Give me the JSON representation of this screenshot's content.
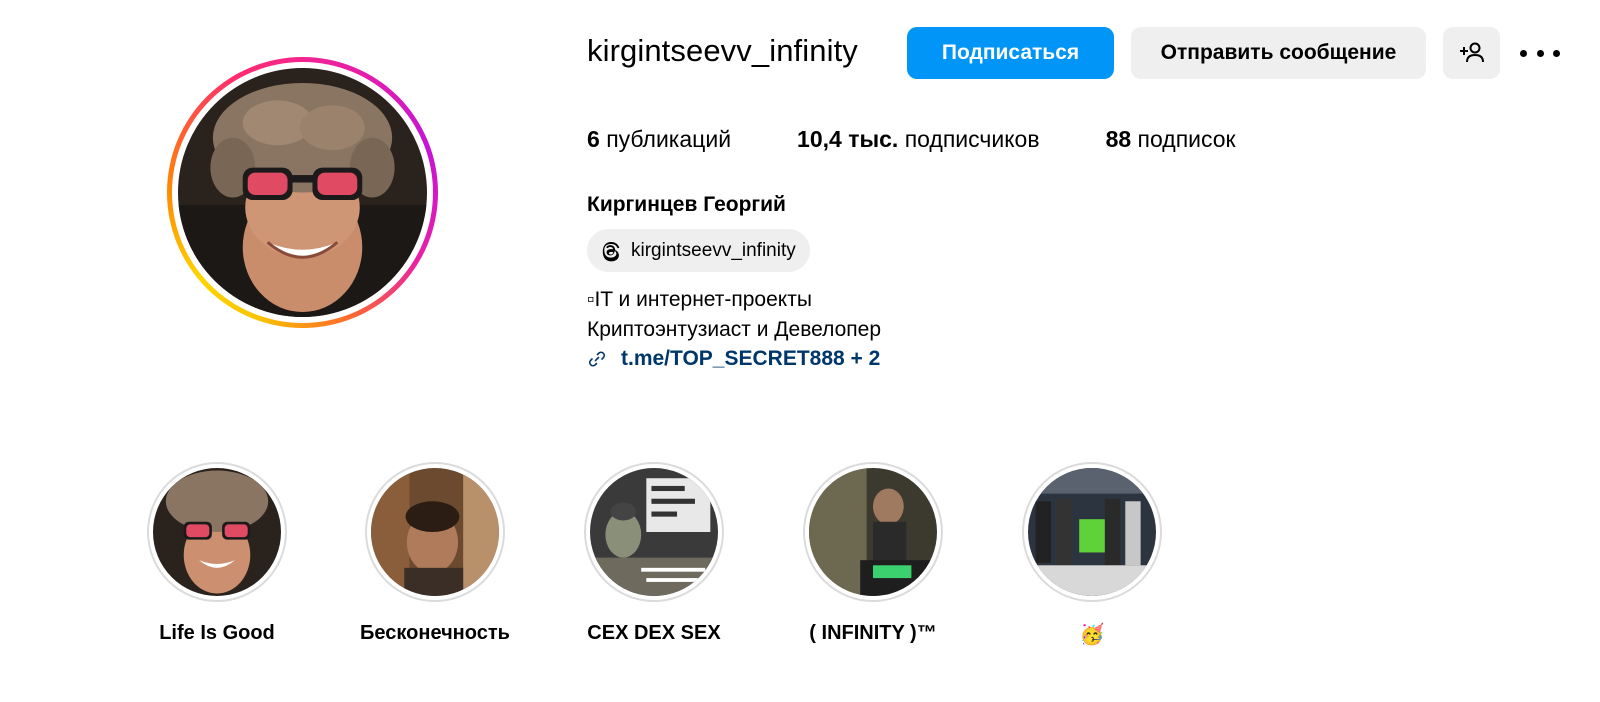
{
  "profile": {
    "username": "kirgintseevv_infinity",
    "full_name": "Киргинцев Георгий",
    "avatar_icon": "profile-photo-sunglasses-fur-hat"
  },
  "actions": {
    "follow_label": "Подписаться",
    "message_label": "Отправить сообщение",
    "add_user_icon": "add-user-icon",
    "more_icon": "more-options-icon"
  },
  "stats": {
    "posts_count": "6",
    "posts_label": "публикаций",
    "followers_count": "10,4 тыс.",
    "followers_label": "подписчиков",
    "following_count": "88",
    "following_label": "подписок"
  },
  "threads": {
    "handle": "kirgintseevv_infinity",
    "icon": "threads-icon"
  },
  "bio": {
    "line1": "▫IT и интернет-проекты",
    "line2": "Криптоэнтузиаст и Девелопер",
    "link_text": "t.me/TOP_SECRET888 + 2",
    "link_icon": "link-icon"
  },
  "highlights": [
    {
      "label": "Life Is Good"
    },
    {
      "label": "Бесконечность"
    },
    {
      "label": "CEX DEX SEX"
    },
    {
      "label": "( INFINITY )™"
    },
    {
      "label": "🥳"
    }
  ],
  "colors": {
    "primary_button": "#0095f6",
    "secondary_button": "#efefef",
    "link": "#00376b"
  }
}
